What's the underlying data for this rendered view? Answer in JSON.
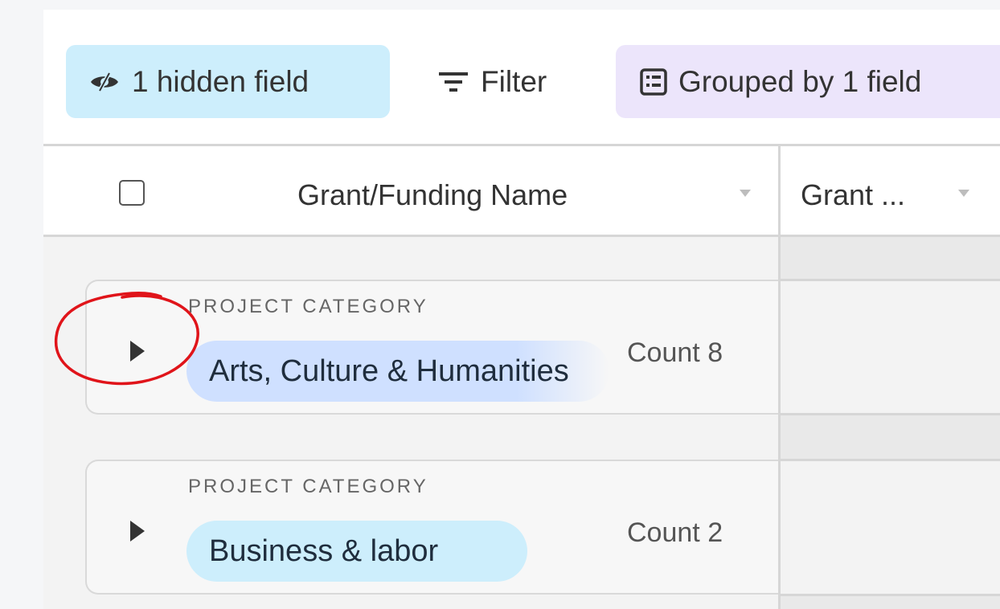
{
  "toolbar": {
    "hidden_fields_label": "1 hidden field",
    "filter_label": "Filter",
    "group_label": "Grouped by 1 field",
    "hidden_icon": "eye-slash-icon",
    "filter_icon": "filter-lines-icon",
    "group_icon": "group-list-icon"
  },
  "table": {
    "columns": [
      {
        "label": "Grant/Funding Name"
      },
      {
        "label": "Grant ..."
      }
    ]
  },
  "groups": [
    {
      "category_label": "PROJECT CATEGORY",
      "value": "Arts, Culture & Humanities",
      "count_label": "Count",
      "count": "8"
    },
    {
      "category_label": "PROJECT CATEGORY",
      "value": "Business & labor",
      "count_label": "Count",
      "count": "2"
    }
  ],
  "colors": {
    "hidden_field_bg": "#cdeefc",
    "grouped_bg": "#ece5fb",
    "chip_arts": "#cfe0ff",
    "chip_business": "#cdeefc",
    "annotation": "#e0141a"
  }
}
